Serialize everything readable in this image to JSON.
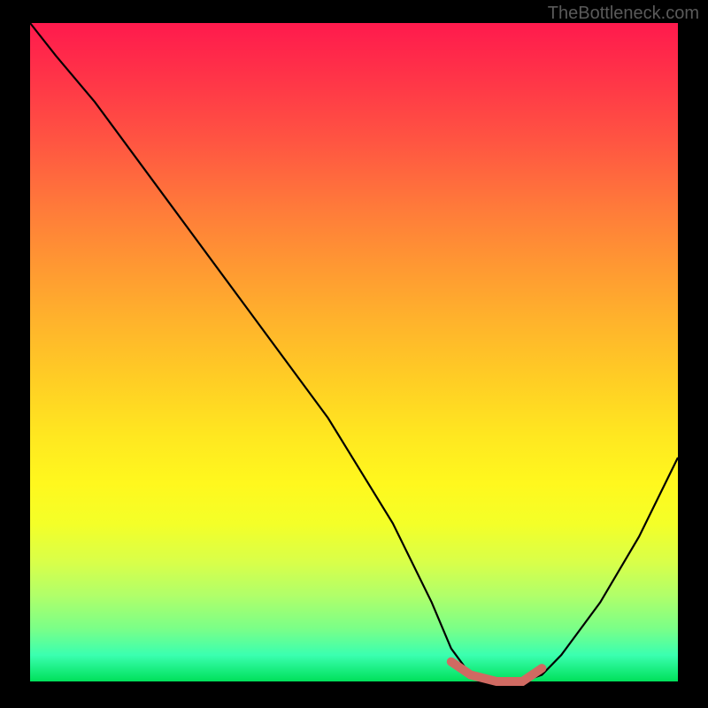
{
  "watermark": "TheBottleneck.com",
  "chart_data": {
    "type": "line",
    "title": "",
    "xlabel": "",
    "ylabel": "",
    "xlim": [
      0,
      100
    ],
    "ylim": [
      0,
      100
    ],
    "series": [
      {
        "name": "bottleneck-curve",
        "x": [
          0,
          4,
          10,
          22,
          34,
          46,
          56,
          62,
          65,
          68,
          72,
          76,
          79,
          82,
          88,
          94,
          100
        ],
        "y": [
          100,
          95,
          88,
          72,
          56,
          40,
          24,
          12,
          5,
          1,
          0,
          0,
          1,
          4,
          12,
          22,
          34
        ],
        "color": "#000000"
      },
      {
        "name": "flat-region-highlight",
        "x": [
          65,
          68,
          72,
          76,
          79
        ],
        "y": [
          3,
          1,
          0,
          0,
          2
        ],
        "color": "#d06a62"
      }
    ],
    "gradient_stops": [
      {
        "pos": 0,
        "color": "#ff1a4d"
      },
      {
        "pos": 50,
        "color": "#ffd024"
      },
      {
        "pos": 75,
        "color": "#fff81e"
      },
      {
        "pos": 100,
        "color": "#00e05a"
      }
    ]
  }
}
